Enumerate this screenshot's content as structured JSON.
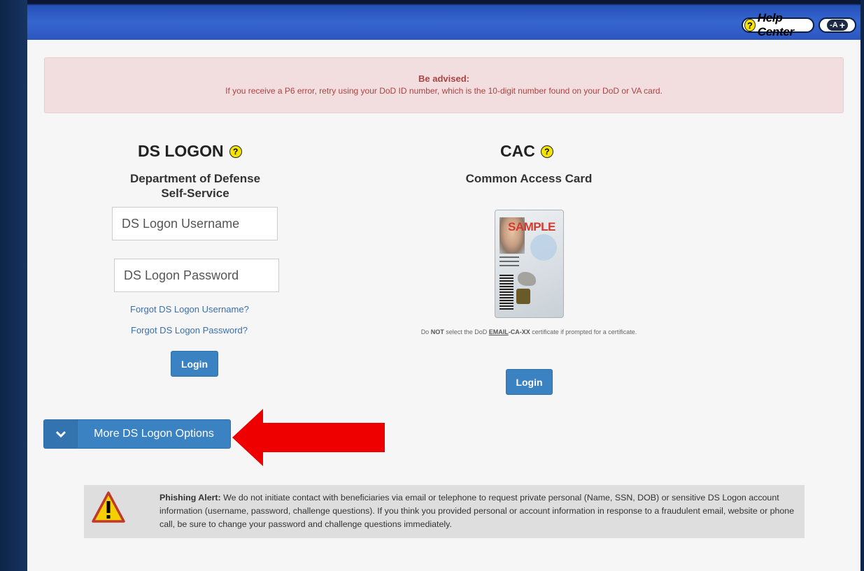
{
  "header": {
    "help_label": "Help Center",
    "help_icon_glyph": "?",
    "font_size_label": "-A",
    "font_size_plus": "+"
  },
  "advisory": {
    "title": "Be advised:",
    "message": "If you receive a P6 error, retry using your DoD ID number, which is the 10-digit number found on your DoD or VA card."
  },
  "ds_logon": {
    "title": "DS LOGON",
    "subtitle_line1": "Department of Defense",
    "subtitle_line2": "Self-Service",
    "username_placeholder": "DS Logon Username",
    "password_placeholder": "DS Logon Password",
    "forgot_username": "Forgot DS Logon Username?",
    "forgot_password": "Forgot DS Logon Password?",
    "login_label": "Login"
  },
  "cac": {
    "title": "CAC",
    "subtitle": "Common Access Card",
    "card_sample_text": "SAMPLE",
    "note_prefix": "Do ",
    "note_not": "NOT",
    "note_mid": " select the DoD ",
    "note_email": "EMAIL",
    "note_cert": "-CA-XX",
    "note_suffix": " certificate if prompted for a certificate.",
    "login_label": "Login"
  },
  "more_options": {
    "label": "More DS Logon Options"
  },
  "phishing": {
    "bold": "Phishing Alert:",
    "text": " We do not initiate contact with beneficiaries via email or telephone to request private personal (Name, SSN, DOB) or sensitive DS Logon account information (username, password, challenge questions). If you think you provided personal or account information in response to a fraudulent email, website or phone call, be sure to change your password and challenge questions immediately."
  },
  "colors": {
    "topbar": "#3766d0",
    "button": "#3b82c2",
    "advisory_bg": "#f2dede",
    "advisory_text": "#a94442",
    "arrow": "#ee0000"
  }
}
